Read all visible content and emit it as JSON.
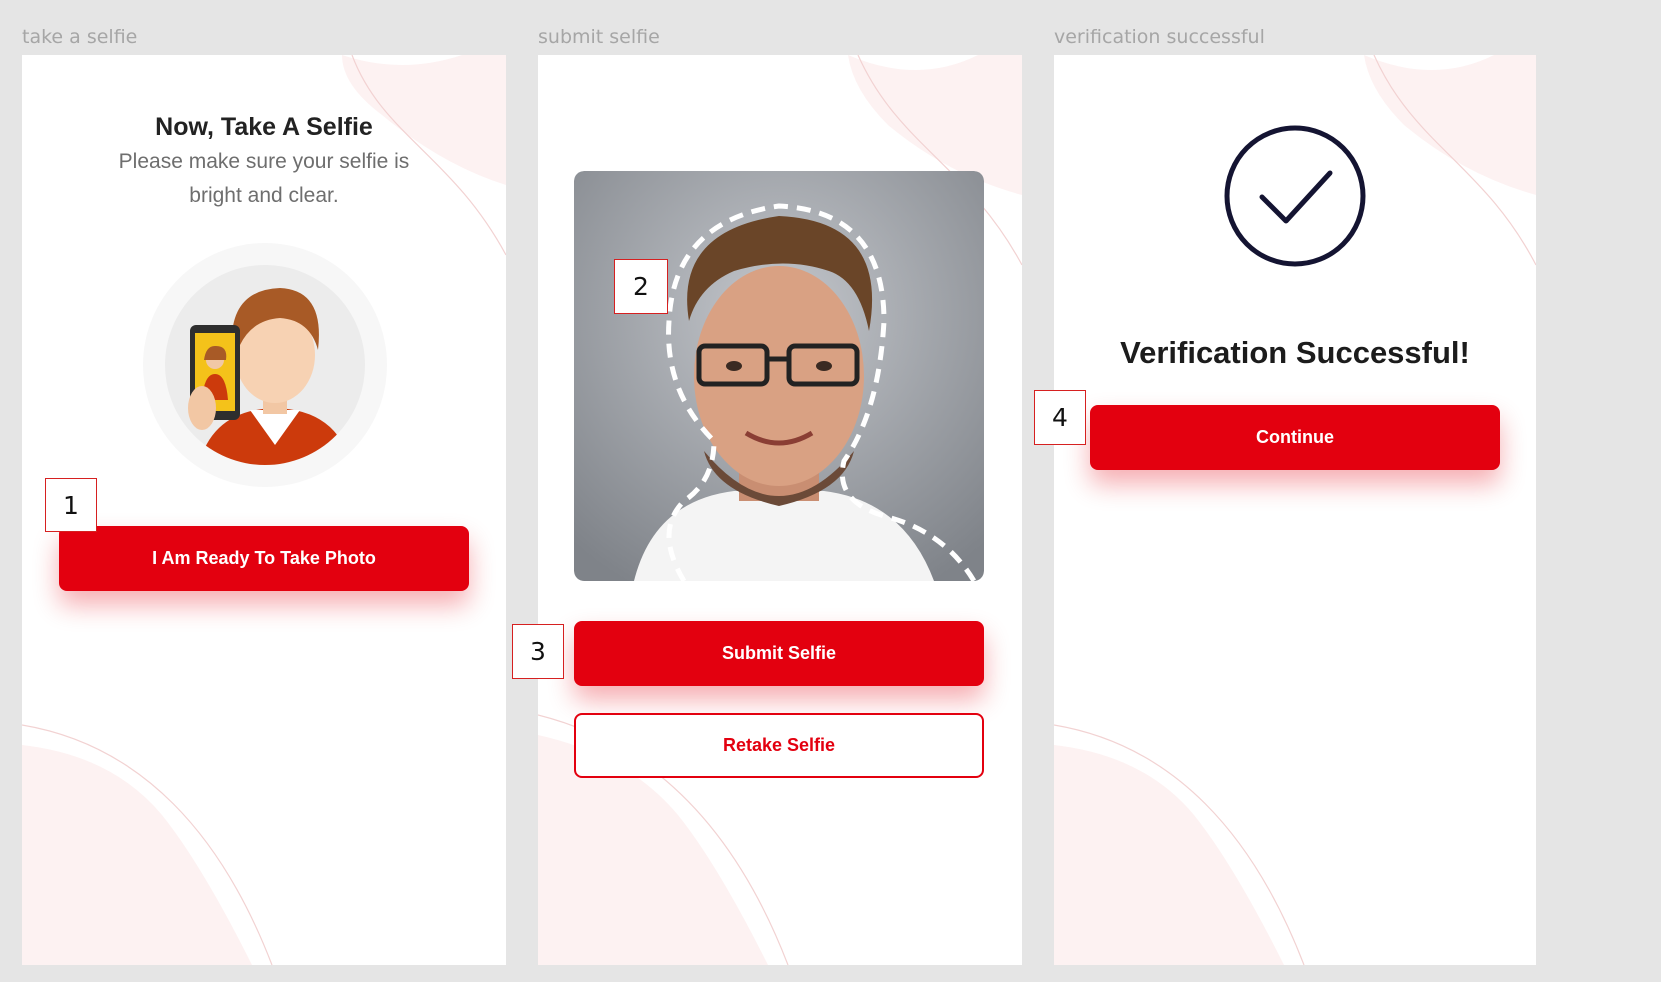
{
  "colors": {
    "background": "#e5e5e5",
    "screen": "#ffffff",
    "primary": "#e3000f",
    "label": "#a6a6a6",
    "checkmark": "#141432"
  },
  "frames": [
    {
      "label": "take a selfie",
      "title": "Now, Take A Selfie",
      "subtitle_lines": [
        "Please make sure your selfie is",
        "bright and clear."
      ],
      "illustration_icon": "selfie-person-icon",
      "button_label": "I Am Ready To Take Photo"
    },
    {
      "label": "submit selfie",
      "photo_icon": "selfie-photo",
      "submit_label": "Submit Selfie",
      "retake_label": "Retake Selfie"
    },
    {
      "label": "verification successful",
      "status_icon": "check-circle-icon",
      "title": "Verification Successful!",
      "button_label": "Continue"
    }
  ],
  "markers": [
    "1",
    "2",
    "3",
    "4"
  ]
}
